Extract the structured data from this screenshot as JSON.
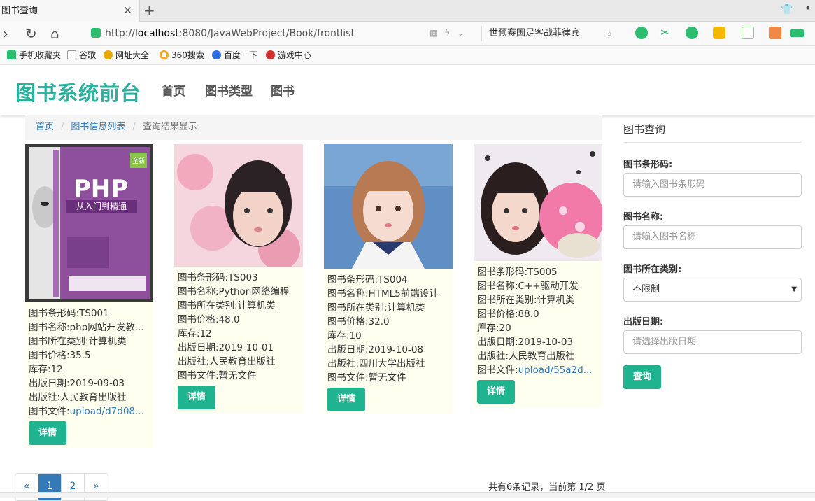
{
  "browser": {
    "tab_title": "图书查询",
    "tab_close": "✕",
    "new_tab": "+",
    "url_prefix": "http://",
    "url_host": "localhost",
    "url_rest": ":8080/JavaWebProject/Book/frontlist",
    "search_text": "世预赛国足客战菲律宾"
  },
  "bookmarks": [
    {
      "label": "手机收藏夹",
      "color": "#2dbd6e"
    },
    {
      "label": "谷歌",
      "color": "#888888"
    },
    {
      "label": "网址大全",
      "color": "#e8a800"
    },
    {
      "label": "360搜索",
      "color": "#f5a623"
    },
    {
      "label": "百度一下",
      "color": "#2d6ee0"
    },
    {
      "label": "游戏中心",
      "color": "#d0312d"
    }
  ],
  "site": {
    "brand": "图书系统前台",
    "menu": [
      "首页",
      "图书类型",
      "图书"
    ]
  },
  "breadcrumb": {
    "home": "首页",
    "sep": "/",
    "list": "图书信息列表",
    "current": "查询结果显示"
  },
  "books": [
    {
      "barcode": "图书条形码:TS001",
      "name": "图书名称:php网站开发教...",
      "category": "图书所在类别:计算机类",
      "price": "图书价格:35.5",
      "stock": "库存:12",
      "date": "出版日期:2019-09-03",
      "publisher": "出版社:人民教育出版社",
      "file_label": "图书文件:",
      "file_value": "upload/d7d08...",
      "button": "详情"
    },
    {
      "barcode": "图书条形码:TS003",
      "name": "图书名称:Python网络编程",
      "category": "图书所在类别:计算机类",
      "price": "图书价格:48.0",
      "stock": "库存:12",
      "date": "出版日期:2019-10-01",
      "publisher": "出版社:人民教育出版社",
      "file_label": "图书文件:暂无文件",
      "file_value": "",
      "button": "详情"
    },
    {
      "barcode": "图书条形码:TS004",
      "name": "图书名称:HTML5前端设计",
      "category": "图书所在类别:计算机类",
      "price": "图书价格:32.0",
      "stock": "库存:10",
      "date": "出版日期:2019-10-08",
      "publisher": "出版社:四川大学出版社",
      "file_label": "图书文件:暂无文件",
      "file_value": "",
      "button": "详情"
    },
    {
      "barcode": "图书条形码:TS005",
      "name": "图书名称:C++驱动开发",
      "category": "图书所在类别:计算机类",
      "price": "图书价格:88.0",
      "stock": "库存:20",
      "date": "出版日期:2019-10-03",
      "publisher": "出版社:人民教育出版社",
      "file_label": "图书文件:",
      "file_value": "upload/55a2d...",
      "button": "详情"
    }
  ],
  "cover": {
    "badge": "全新",
    "title": "PHP",
    "subtitle": "从入门到精通",
    "side_text": "PHP从入门到精通"
  },
  "sidebar": {
    "title": "图书查询",
    "barcode_label": "图书条形码:",
    "barcode_placeholder": "请输入图书条形码",
    "name_label": "图书名称:",
    "name_placeholder": "请输入图书名称",
    "category_label": "图书所在类别:",
    "category_value": "不限制",
    "date_label": "出版日期:",
    "date_placeholder": "请选择出版日期",
    "submit": "查询"
  },
  "pagination": {
    "prev": "«",
    "pages": [
      "1",
      "2"
    ],
    "next": "»",
    "summary": "共有6条记录，当前第 1/2 页"
  }
}
